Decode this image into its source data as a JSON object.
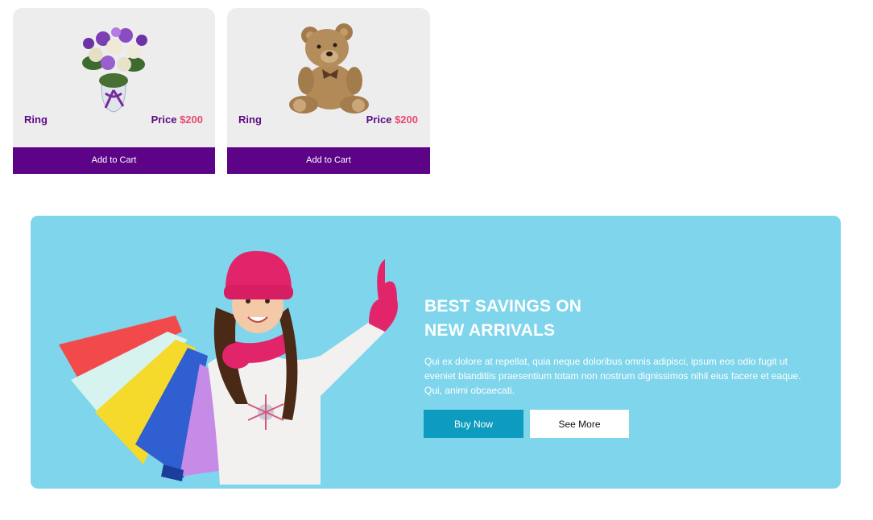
{
  "products": [
    {
      "name": "Ring",
      "price_label": "Price",
      "price_value": "$200",
      "cart_label": "Add to Cart",
      "image": "flower-bouquet-image"
    },
    {
      "name": "Ring",
      "price_label": "Price",
      "price_value": "$200",
      "cart_label": "Add to Cart",
      "image": "teddy-bear-image"
    }
  ],
  "banner": {
    "title_line1": "BEST SAVINGS ON",
    "title_line2": "NEW ARRIVALS",
    "body": "Qui ex dolore at repellat, quia neque doloribus omnis adipisci, ipsum eos odio fugit ut eveniet blanditiis praesentium totam non nostrum dignissimos nihil eius facere et eaque. Qui, animi obcaecati.",
    "buy_label": "Buy Now",
    "more_label": "See More",
    "image": "girl-with-shopping-bags-image"
  },
  "colors": {
    "brand_purple": "#5c0387",
    "price_accent": "#e84a6f",
    "banner_bg": "#7fd5eb",
    "buy_button": "#0d9cbf"
  }
}
